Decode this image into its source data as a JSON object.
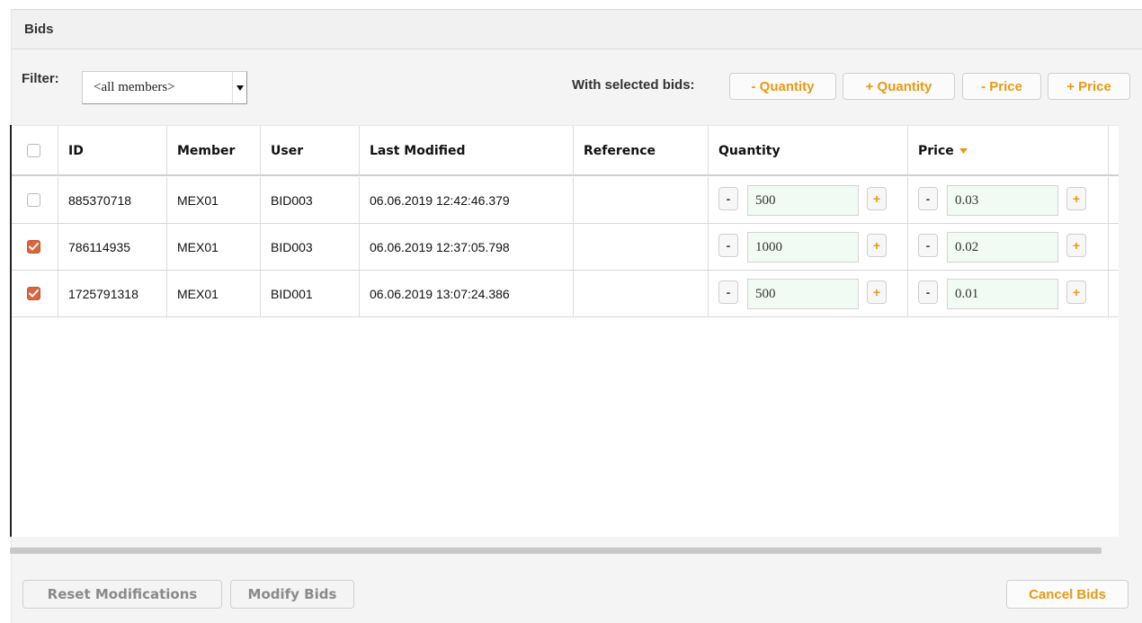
{
  "panel": {
    "title": "Bids"
  },
  "toolbar": {
    "filter_label": "Filter:",
    "filter_value": "<all members>",
    "with_selected_label": "With selected bids:",
    "minus_quantity": "- Quantity",
    "plus_quantity": "+ Quantity",
    "minus_price": "- Price",
    "plus_price": "+ Price"
  },
  "table": {
    "columns": {
      "id": "ID",
      "member": "Member",
      "user": "User",
      "last_modified": "Last Modified",
      "reference": "Reference",
      "quantity": "Quantity",
      "price": "Price"
    },
    "sort": {
      "column": "price",
      "direction": "descending",
      "icon": "sort-down-icon",
      "color": "#e79a14"
    },
    "stepper": {
      "minus": "-",
      "plus": "+"
    },
    "rows": [
      {
        "selected": false,
        "id": "885370718",
        "member": "MEX01",
        "user": "BID003",
        "last_modified": "06.06.2019 12:42:46.379",
        "reference": "",
        "quantity": "500",
        "price": "0.03"
      },
      {
        "selected": true,
        "id": "786114935",
        "member": "MEX01",
        "user": "BID003",
        "last_modified": "06.06.2019 12:37:05.798",
        "reference": "",
        "quantity": "1000",
        "price": "0.02"
      },
      {
        "selected": true,
        "id": "1725791318",
        "member": "MEX01",
        "user": "BID001",
        "last_modified": "06.06.2019 13:07:24.386",
        "reference": "",
        "quantity": "500",
        "price": "0.01"
      }
    ]
  },
  "footer": {
    "reset_label": "Reset Modifications",
    "modify_label": "Modify Bids",
    "cancel_label": "Cancel Bids"
  },
  "colors": {
    "accent": "#e79a14",
    "checkbox_checked": "#d9663e",
    "input_bg": "#f1fbf4"
  }
}
